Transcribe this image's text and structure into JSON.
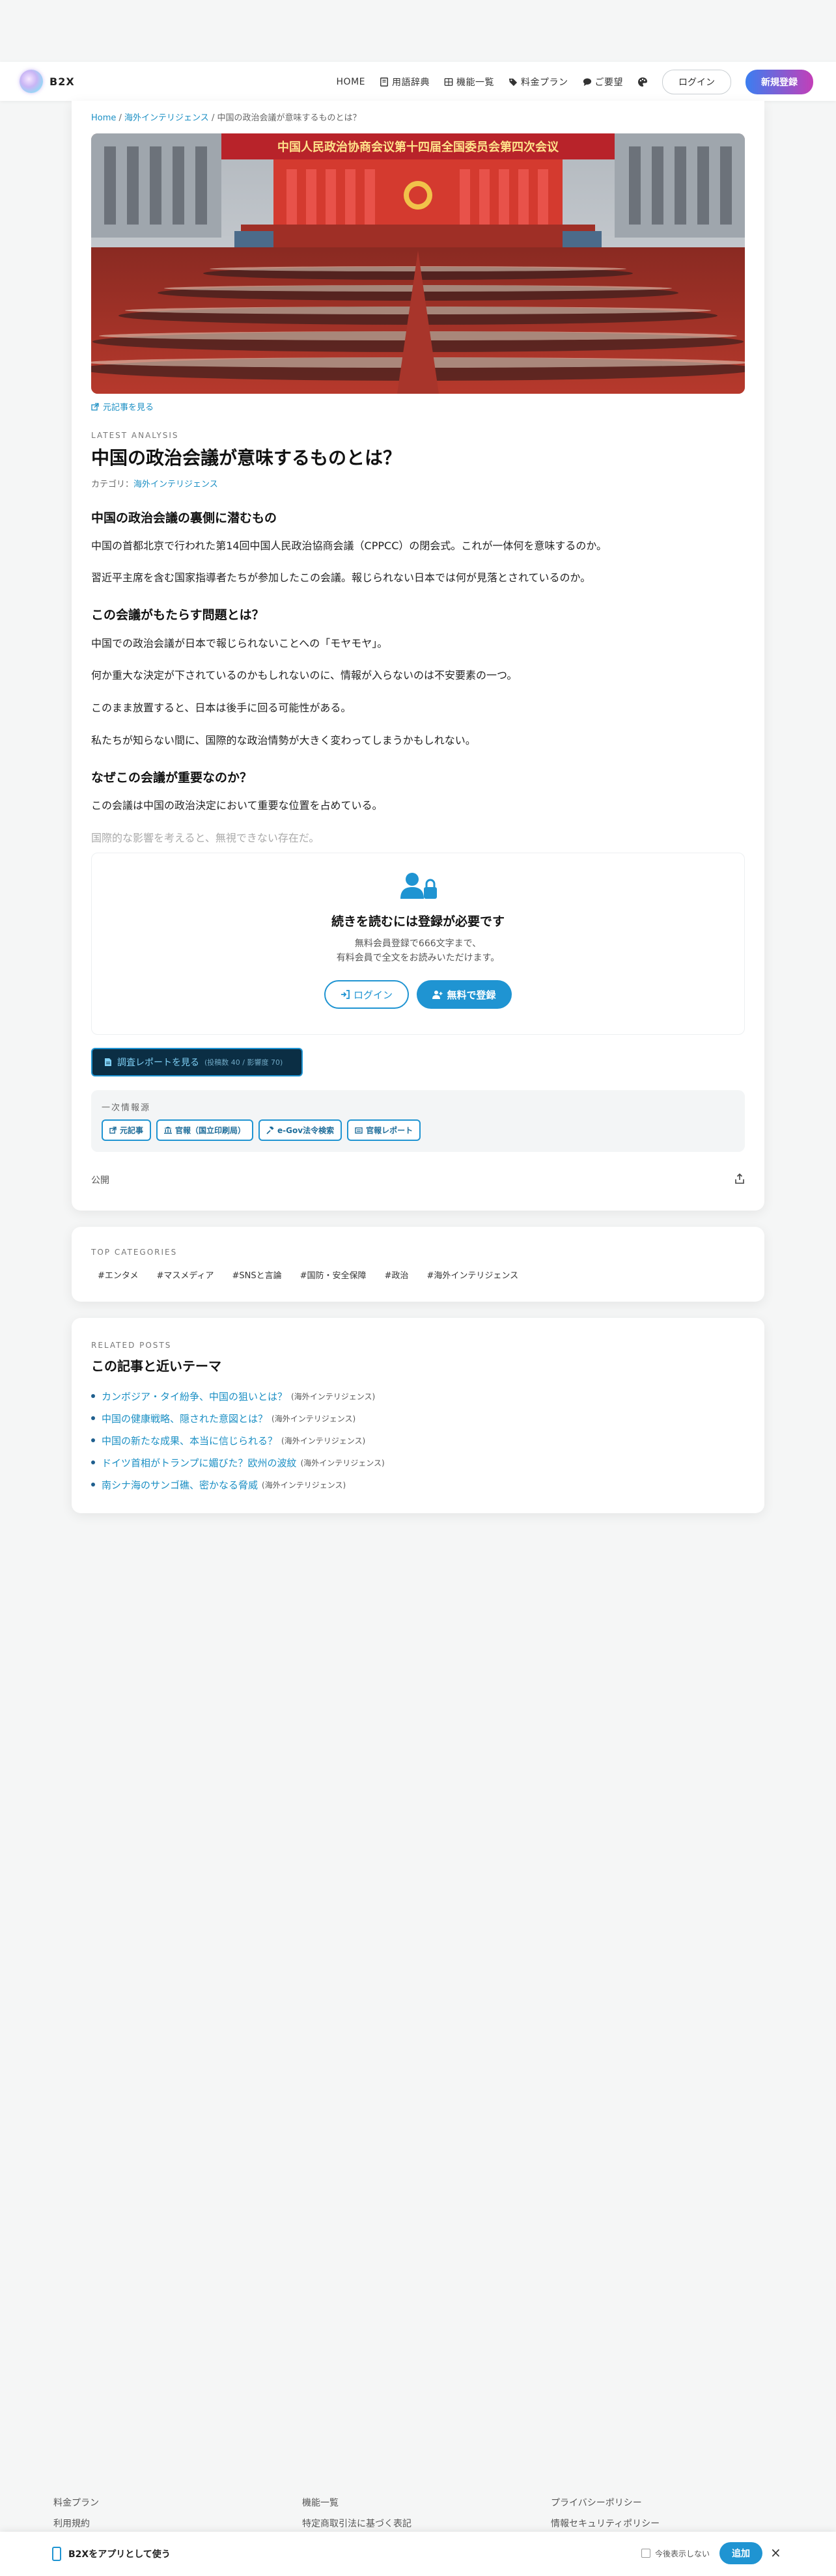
{
  "header": {
    "logo_text": "B2X",
    "nav": {
      "home": "HOME",
      "glossary": "用語辞典",
      "features": "機能一覧",
      "pricing": "料金プラン",
      "requests": "ご要望",
      "login": "ログイン",
      "signup": "新規登録"
    }
  },
  "breadcrumb": {
    "home": "Home",
    "category": "海外インテリジェンス",
    "current": "中国の政治会議が意味するものとは？"
  },
  "hero": {
    "banner_text": "中国人民政治协商会议第十四届全国委员会第四次会议"
  },
  "article": {
    "source_link": "元記事を見る",
    "eyebrow": "LATEST ANALYSIS",
    "title": "中国の政治会議が意味するものとは？",
    "category_label": "カテゴリ：",
    "category": "海外インテリジェンス",
    "h1": "中国の政治会議の裏側に潜むもの",
    "p1": "中国の首都北京で行われた第14回中国人民政治協商会議（CPPCC）の閉会式。これが一体何を意味するのか。",
    "p2": "習近平主席を含む国家指導者たちが参加したこの会議。報じられない日本では何が見落とされているのか。",
    "h2": "この会議がもたらす問題とは？",
    "p3": "中国での政治会議が日本で報じられないことへの「モヤモヤ」。",
    "p4": "何か重大な決定が下されているのかもしれないのに、情報が入らないのは不安要素の一つ。",
    "p5": "このまま放置すると、日本は後手に回る可能性がある。",
    "p6": "私たちが知らない間に、国際的な政治情勢が大きく変わってしまうかもしれない。",
    "h3": "なぜこの会議が重要なのか？",
    "p7": "この会議は中国の政治決定において重要な位置を占めている。",
    "p8": "国際的な影響を考えると、無視できない存在だ。"
  },
  "paywall": {
    "title": "続きを読むには登録が必要です",
    "sub1": "無料会員登録で666文字まで、",
    "sub2": "有料会員で全文をお読みいただけます。",
    "login": "ログイン",
    "signup": "無料で登録"
  },
  "report": {
    "label": "調査レポートを見る",
    "meta": "(投稿数 40 / 影響度 70)"
  },
  "sources": {
    "label": "一次情報源",
    "chips": [
      "元記事",
      "官報（国立印刷局）",
      "e-Gov法令検索",
      "官報レポート"
    ]
  },
  "public_label": "公開",
  "top_categories": {
    "eyebrow": "TOP CATEGORIES",
    "items": [
      "#エンタメ",
      "#マスメディア",
      "#SNSと言論",
      "#国防・安全保障",
      "#政治",
      "#海外インテリジェンス"
    ]
  },
  "related": {
    "eyebrow": "RELATED POSTS",
    "title": "この記事と近いテーマ",
    "items": [
      {
        "title": "カンボジア・タイ紛争、中国の狙いとは？",
        "tag": "(海外インテリジェンス)"
      },
      {
        "title": "中国の健康戦略、隠された意図とは？",
        "tag": "(海外インテリジェンス)"
      },
      {
        "title": "中国の新たな成果、本当に信じられる？",
        "tag": "(海外インテリジェンス)"
      },
      {
        "title": "ドイツ首相がトランプに媚びた？欧州の波紋",
        "tag": "(海外インテリジェンス)"
      },
      {
        "title": "南シナ海のサンゴ礁、密かなる脅威",
        "tag": "(海外インテリジェンス)"
      }
    ]
  },
  "footer": {
    "col1": [
      "料金プラン",
      "利用規約"
    ],
    "col2": [
      "機能一覧",
      "特定商取引法に基づく表記"
    ],
    "col3": [
      "プライバシーポリシー",
      "情報セキュリティポリシー"
    ]
  },
  "app_banner": {
    "text": "B2Xをアプリとして使う",
    "dont_show": "今後表示しない",
    "add": "追加",
    "close": "×"
  }
}
